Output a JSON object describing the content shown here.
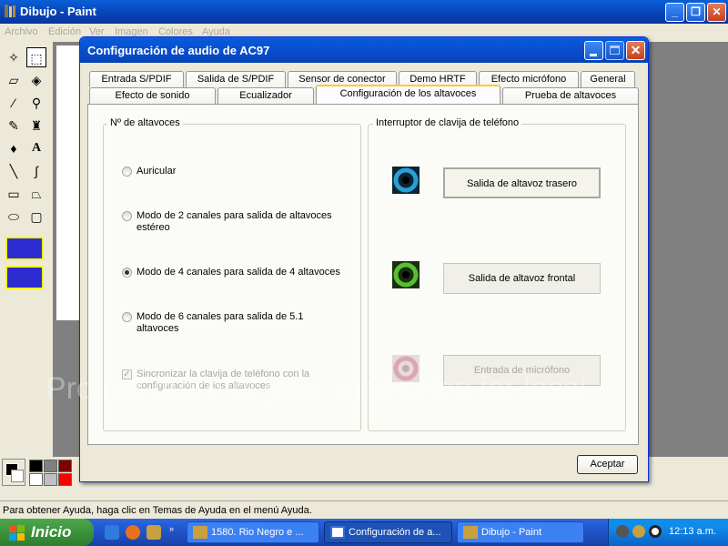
{
  "paint": {
    "title": "Dibujo - Paint",
    "menu": [
      "Archivo",
      "Edición",
      "Ver",
      "Imagen",
      "Colores",
      "Ayuda"
    ],
    "status": "Para obtener Ayuda, haga clic en Temas de Ayuda en el menú Ayuda."
  },
  "dialog": {
    "title": "Configuración de audio de AC97",
    "tabs_row1": [
      "Entrada S/PDIF",
      "Salida de S/PDIF",
      "Sensor de conector",
      "Demo HRTF",
      "Efecto micrófono",
      "General"
    ],
    "tabs_row2": [
      "Efecto de sonido",
      "Ecualizador",
      "Configuración de los altavoces",
      "Prueba de altavoces"
    ],
    "active_tab": "Configuración de los altavoces",
    "speakers_group": {
      "legend": "Nº de altavoces",
      "options": [
        {
          "label": "Auricular",
          "checked": false
        },
        {
          "label": "Modo de 2 canales para salida de altavoces estéreo",
          "checked": false
        },
        {
          "label": "Modo de 4 canales para salida de 4 altavoces",
          "checked": true
        },
        {
          "label": "Modo de 6 canales para salida de 5.1 altavoces",
          "checked": false
        }
      ],
      "sync_checkbox": {
        "label": "Sincronizar la clavija de teléfono con la configuración de los altavoces",
        "checked": true,
        "disabled": true
      }
    },
    "jack_group": {
      "legend": "Interruptor de clavija de teléfono",
      "buttons": [
        {
          "label": "Salida de altavoz trasero",
          "state": "pressed",
          "icon": "jack-blue-icon",
          "color": "#2a9fd6"
        },
        {
          "label": "Salida de altavoz frontal",
          "state": "normal",
          "icon": "jack-green-icon",
          "color": "#58c030"
        },
        {
          "label": "Entrada de micrófono",
          "state": "disabled",
          "icon": "jack-pink-icon",
          "color": "#d8a8b0"
        }
      ]
    },
    "accept_label": "Aceptar"
  },
  "taskbar": {
    "start_label": "Inicio",
    "tasks": [
      {
        "label": "1580. Rio Negro e ...",
        "active": false
      },
      {
        "label": "Configuración de a...",
        "active": true
      },
      {
        "label": "Dibujo - Paint",
        "active": false
      }
    ],
    "clock": "12:13 a.m."
  },
  "watermark": "Protect more of your memories for less!",
  "colors": {
    "titlebar": "#0a5fd8",
    "start_green": "#3c923c",
    "tab_accent": "#ffc83c",
    "canvas_gray": "#808080"
  }
}
